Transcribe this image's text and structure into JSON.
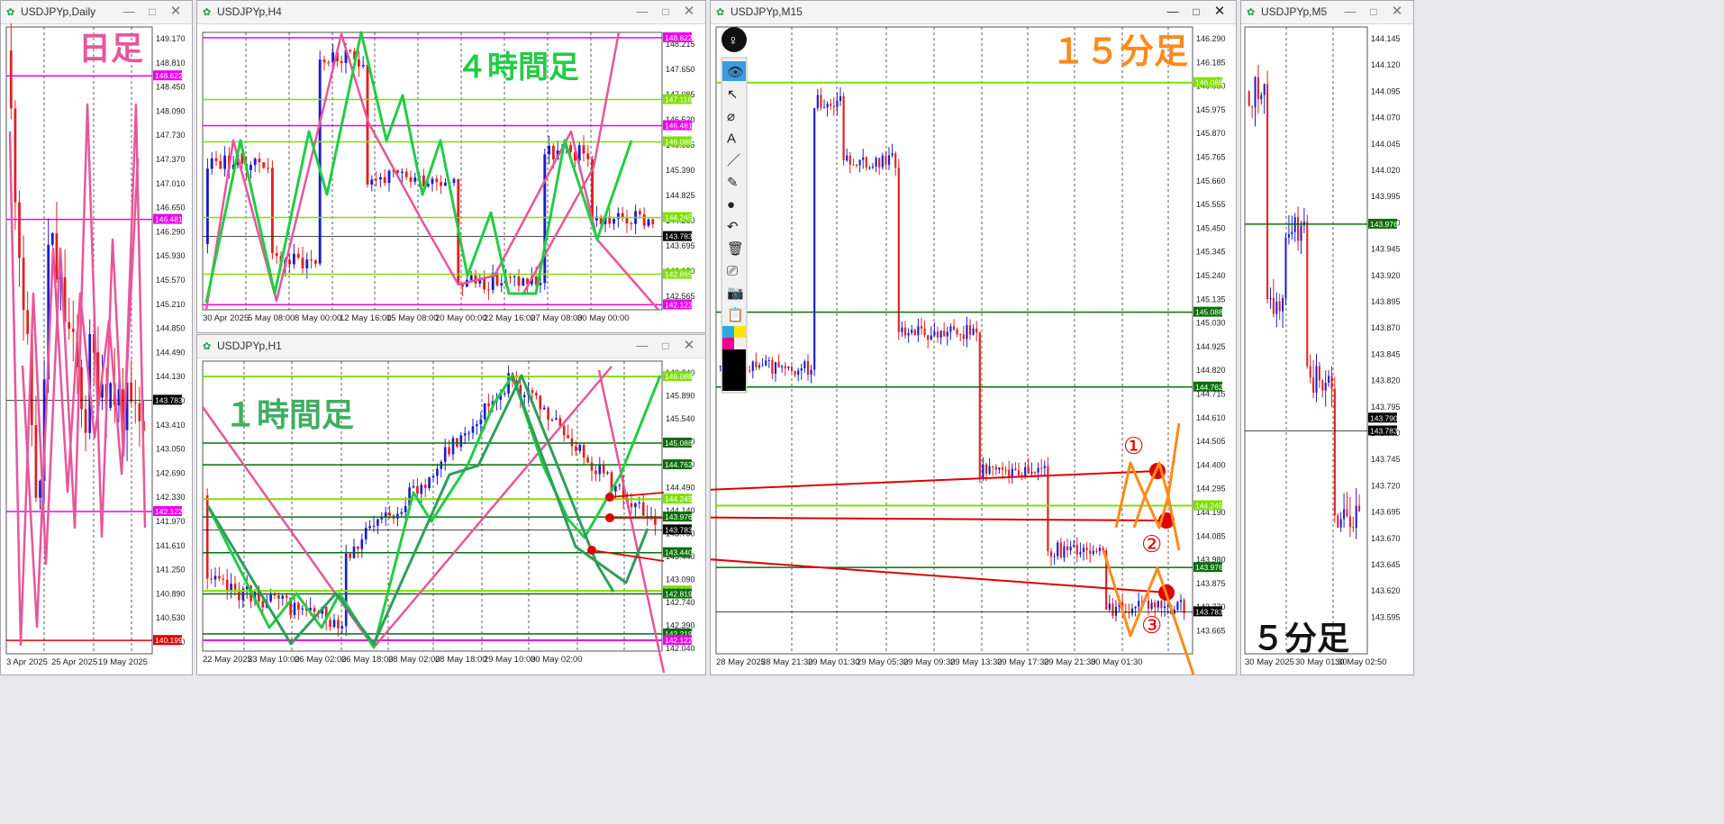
{
  "windows": {
    "daily": {
      "title": "USDJPYp,Daily",
      "timeframe_label": "日足",
      "prices": [
        "149.170",
        "148.810",
        "148.450",
        "148.090",
        "147.730",
        "147.370",
        "147.010",
        "146.650",
        "146.290",
        "145.930",
        "145.570",
        "145.210",
        "144.850",
        "144.490",
        "144.130",
        "143.770",
        "143.410",
        "143.050",
        "142.690",
        "142.330",
        "141.970",
        "141.610",
        "141.250",
        "140.890",
        "140.530",
        "140.170"
      ],
      "tags": {
        "magenta_top": "148.622",
        "magenta_mid": "146.481",
        "current": "143.783",
        "magenta_low": "142.122",
        "red_low": "140.199"
      },
      "dates": [
        "3 Apr 2025",
        "25 Apr 2025",
        "19 May 2025"
      ]
    },
    "h4": {
      "title": "USDJPYp,H4",
      "timeframe_label": "４時間足",
      "prices": [
        "148.215",
        "147.650",
        "147.085",
        "146.520",
        "145.955",
        "145.390",
        "144.825",
        "144.260",
        "143.695",
        "143.130",
        "142.565"
      ],
      "tags": {
        "magenta_top": "148.622",
        "green_1": "147.116",
        "magenta_mid": "146.481",
        "green_2": "146.088",
        "green_3": "144.245",
        "current": "143.783",
        "green_4": "142.865",
        "magenta_low": "142.122"
      },
      "dates": [
        "30 Apr 2025",
        "5 May 08:00",
        "8 May 00:00",
        "12 May 16:00",
        "15 May 08:00",
        "20 May 00:00",
        "22 May 16:00",
        "27 May 08:00",
        "30 May 00:00"
      ]
    },
    "h1": {
      "title": "USDJPYp,H1",
      "timeframe_label": "１時間足",
      "prices": [
        "146.240",
        "145.890",
        "145.540",
        "145.190",
        "144.840",
        "144.490",
        "144.140",
        "143.790",
        "143.440",
        "143.090",
        "142.740",
        "142.390",
        "142.040"
      ],
      "tags": {
        "lime_1": "146.088",
        "dark_1": "145.088",
        "dark_2": "144.762",
        "lime_2": "144.245",
        "dark_3": "143.976",
        "current": "143.783",
        "dark_4": "143.440",
        "lime_3": "142.865",
        "dark_5": "142.819",
        "dark_6": "142.219",
        "magenta_low": "142.122"
      },
      "dates": [
        "22 May 2025",
        "23 May 10:00",
        "26 May 02:00",
        "26 May 18:00",
        "28 May 02:00",
        "28 May 18:00",
        "29 May 10:00",
        "30 May 02:00"
      ]
    },
    "m15": {
      "title": "USDJPYp,M15",
      "timeframe_label": "１５分足",
      "prices": [
        "146.290",
        "146.185",
        "146.080",
        "145.975",
        "145.870",
        "145.765",
        "145.660",
        "145.555",
        "145.450",
        "145.345",
        "145.240",
        "145.135",
        "145.030",
        "144.925",
        "144.820",
        "144.715",
        "144.610",
        "144.505",
        "144.400",
        "144.295",
        "144.190",
        "144.085",
        "143.980",
        "143.875",
        "143.770",
        "143.665"
      ],
      "tags": {
        "lime_top": "146.088",
        "dark_1": "145.088",
        "dark_2": "144.762",
        "lime_2": "144.245",
        "dark_3": "143.976",
        "current": "143.783"
      },
      "dates": [
        "28 May 2025",
        "28 May 21:30",
        "29 May 01:30",
        "29 May 05:30",
        "29 May 09:30",
        "29 May 13:30",
        "29 May 17:30",
        "29 May 21:30",
        "30 May 01:30"
      ],
      "markers": [
        "①",
        "②",
        "③"
      ]
    },
    "m5": {
      "title": "USDJPYp,M5",
      "timeframe_label": "５分足",
      "prices": [
        "144.145",
        "144.120",
        "144.095",
        "144.070",
        "144.045",
        "144.020",
        "143.995",
        "143.970",
        "143.945",
        "143.920",
        "143.895",
        "143.870",
        "143.845",
        "143.820",
        "143.795",
        "143.770",
        "143.745",
        "143.720",
        "143.695",
        "143.670",
        "143.645",
        "143.620",
        "143.595"
      ],
      "tags": {
        "dark_1": "143.976",
        "price_a": "143.790",
        "current": "143.783"
      },
      "dates": [
        "30 May 2025",
        "30 May 01:30",
        "30 May 02:50"
      ]
    }
  },
  "window_buttons": {
    "minimize": "—",
    "maximize": "□",
    "close": "✕"
  },
  "toolbar": {
    "items": [
      {
        "name": "hide-icon",
        "glyph": "👁"
      },
      {
        "name": "cursor-icon",
        "glyph": "↖"
      },
      {
        "name": "eraser-icon",
        "glyph": "⌀"
      },
      {
        "name": "text-icon",
        "glyph": "A"
      },
      {
        "name": "line-icon",
        "glyph": "／"
      },
      {
        "name": "pen-icon",
        "glyph": "✎"
      },
      {
        "name": "dot-icon",
        "glyph": "●"
      },
      {
        "name": "undo-icon",
        "glyph": "↶"
      },
      {
        "name": "trash-icon",
        "glyph": "🗑"
      },
      {
        "name": "projector-icon",
        "glyph": "⎚"
      },
      {
        "name": "camera-icon",
        "glyph": "📷"
      },
      {
        "name": "clipboard-icon",
        "glyph": "📋"
      }
    ],
    "palette": [
      "#29abe2",
      "#ffe600",
      "#ec008c",
      "#000000"
    ]
  },
  "colors": {
    "bull": "#1c1ccc",
    "bear": "#e02020",
    "pink": "#e8559a",
    "lime": "#7fe000",
    "green_zz": "#22cc44",
    "dark_green": "#0b6e0b",
    "magenta": "#ee00ee",
    "orange": "#ff8a1a",
    "red": "#e00000",
    "current": "#000000"
  }
}
